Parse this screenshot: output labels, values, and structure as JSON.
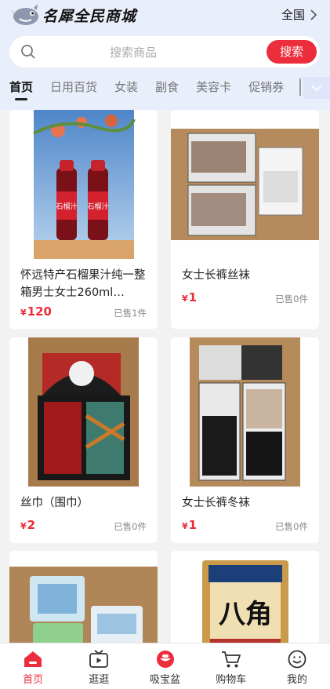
{
  "header": {
    "app_name": "名犀全民商城",
    "region": "全国",
    "search_placeholder": "搜索商品",
    "search_button": "搜索"
  },
  "tabs": [
    {
      "label": "首页",
      "active": true
    },
    {
      "label": "日用百货"
    },
    {
      "label": "女装"
    },
    {
      "label": "副食"
    },
    {
      "label": "美容卡"
    },
    {
      "label": "促销券"
    }
  ],
  "products": [
    {
      "title": "怀远特产石榴果汁纯一整箱男士女士260ml…",
      "currency": "¥",
      "price": "120",
      "sold": "已售1件",
      "image": "pomegranate-juice-bottles",
      "image_text": "石榴汁"
    },
    {
      "title": "女士长裤丝袜",
      "currency": "¥",
      "price": "1",
      "sold": "已售0件",
      "image": "pantyhose-packages"
    },
    {
      "title": "丝巾（围巾）",
      "currency": "¥",
      "price": "2",
      "sold": "已售0件",
      "image": "silk-scarf-box"
    },
    {
      "title": "女士长裤冬袜",
      "currency": "¥",
      "price": "1",
      "sold": "已售0件",
      "image": "winter-tights-packages"
    },
    {
      "title": "",
      "currency": "",
      "price": "",
      "sold": "",
      "image": "tissue-packs"
    },
    {
      "title": "",
      "currency": "",
      "price": "",
      "sold": "",
      "image": "star-anise-bag",
      "image_text": "八角"
    }
  ],
  "bottom_nav": [
    {
      "label": "首页",
      "icon": "home-icon",
      "active": true
    },
    {
      "label": "逛逛",
      "icon": "play-video-icon"
    },
    {
      "label": "吸宝盆",
      "icon": "treasure-bowl-icon"
    },
    {
      "label": "购物车",
      "icon": "cart-icon"
    },
    {
      "label": "我的",
      "icon": "smile-profile-icon"
    }
  ],
  "colors": {
    "accent": "#ec2d3b",
    "header_bg": "#e9eefb",
    "page_bg": "#f2f2f2"
  }
}
